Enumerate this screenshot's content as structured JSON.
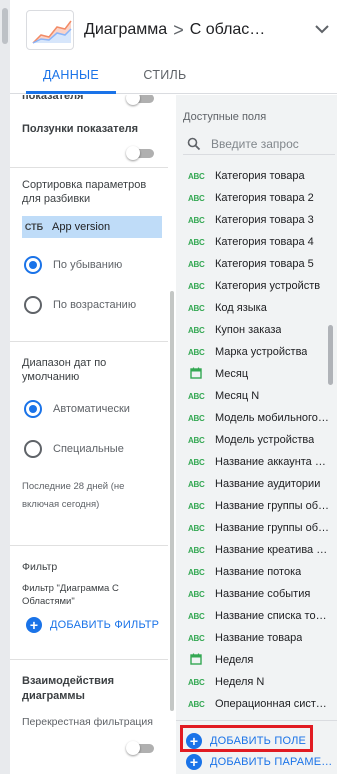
{
  "header": {
    "title": "Диаграмма",
    "subtitle": "С облас…",
    "separator": ">"
  },
  "tabs": [
    {
      "label": "ДАННЫЕ",
      "active": true
    },
    {
      "label": "СТИЛЬ",
      "active": false
    }
  ],
  "left": {
    "partial_label": "показателя",
    "sliders_label": "Ползунки показателя",
    "sort_heading": "Сортировка параметров для разбивки",
    "sort_chip": {
      "badge": "СТБ",
      "value": "App version"
    },
    "sort_desc": "По убыванию",
    "sort_asc": "По возрастанию",
    "date_heading": "Диапазон дат по умолчанию",
    "date_auto": "Автоматически",
    "date_custom": "Специальные",
    "date_note": "Последние 28 дней (не включая сегодня)",
    "filter_heading": "Фильтр",
    "filter_name": "Фильтр \"Диаграмма С Областями\"",
    "add_filter": "ДОБАВИТЬ ФИЛЬТР",
    "interactions_heading": "Взаимодействия диаграммы",
    "cross_filter": "Перекрестная фильтрация"
  },
  "right": {
    "title": "Доступные поля",
    "search_placeholder": "Введите запрос",
    "fields": [
      {
        "type": "ABC",
        "name": "Категория товара"
      },
      {
        "type": "ABC",
        "name": "Категория товара 2"
      },
      {
        "type": "ABC",
        "name": "Категория товара 3"
      },
      {
        "type": "ABC",
        "name": "Категория товара 4"
      },
      {
        "type": "ABC",
        "name": "Категория товара 5"
      },
      {
        "type": "ABC",
        "name": "Категория устройств"
      },
      {
        "type": "ABC",
        "name": "Код языка"
      },
      {
        "type": "ABC",
        "name": "Купон заказа"
      },
      {
        "type": "ABC",
        "name": "Марка устройства"
      },
      {
        "type": "date",
        "name": "Месяц"
      },
      {
        "type": "ABC",
        "name": "Месяц N"
      },
      {
        "type": "ABC",
        "name": "Модель мобильного …"
      },
      {
        "type": "ABC",
        "name": "Модель устройства"
      },
      {
        "type": "ABC",
        "name": "Название аккаунта …"
      },
      {
        "type": "ABC",
        "name": "Название аудитории"
      },
      {
        "type": "ABC",
        "name": "Название группы об…"
      },
      {
        "type": "ABC",
        "name": "Название группы об…"
      },
      {
        "type": "ABC",
        "name": "Название креатива …"
      },
      {
        "type": "ABC",
        "name": "Название потока"
      },
      {
        "type": "ABC",
        "name": "Название события"
      },
      {
        "type": "ABC",
        "name": "Название списка то…"
      },
      {
        "type": "ABC",
        "name": "Название товара"
      },
      {
        "type": "date",
        "name": "Неделя"
      },
      {
        "type": "ABC",
        "name": "Неделя N"
      },
      {
        "type": "ABC",
        "name": "Операционная систе…"
      }
    ],
    "add_field": "ДОБАВИТЬ ПОЛЕ",
    "add_param": "ДОБАВИТЬ ПАРАМЕ…"
  },
  "colors": {
    "accent": "#1a73e8",
    "field_text_type": "#34a853",
    "highlight": "#e11b22",
    "chip": "#bfdcf8"
  }
}
